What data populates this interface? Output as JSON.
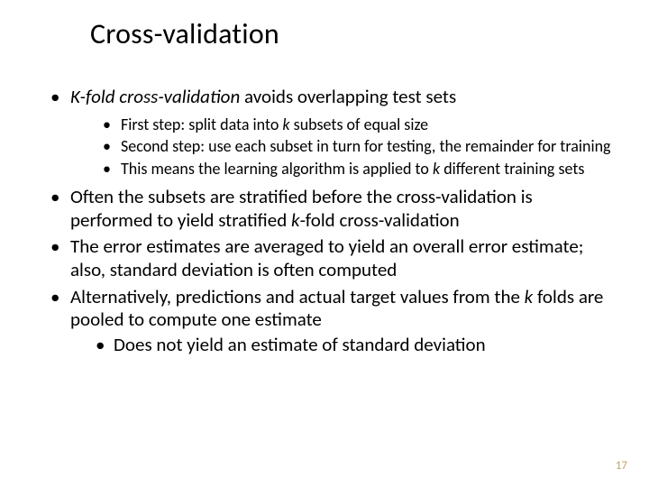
{
  "title": "Cross-validation",
  "bullets": {
    "b1_pre_i": "K-fold cross-validation",
    "b1_post": " avoids overlapping test sets",
    "b1_sub1_pre": "First step: split data into ",
    "b1_sub1_i": "k",
    "b1_sub1_post": " subsets of equal size",
    "b1_sub2": "Second step: use each subset in turn for testing, the remainder for training",
    "b1_sub3_pre": "This means the learning algorithm is applied to ",
    "b1_sub3_i": "k",
    "b1_sub3_post": " different training sets",
    "b2_pre": "Often the subsets are stratified before the cross-validation is performed to yield stratified ",
    "b2_i": "k",
    "b2_post": "-fold cross-validation",
    "b3": "The error estimates are averaged to yield an overall error estimate; also, standard deviation is often computed",
    "b4_pre": "Alternatively, predictions and actual target values from the ",
    "b4_i": "k",
    "b4_post": " folds are pooled to compute one estimate",
    "b4_sub1": "Does not yield an estimate of standard deviation"
  },
  "page_number": "17"
}
